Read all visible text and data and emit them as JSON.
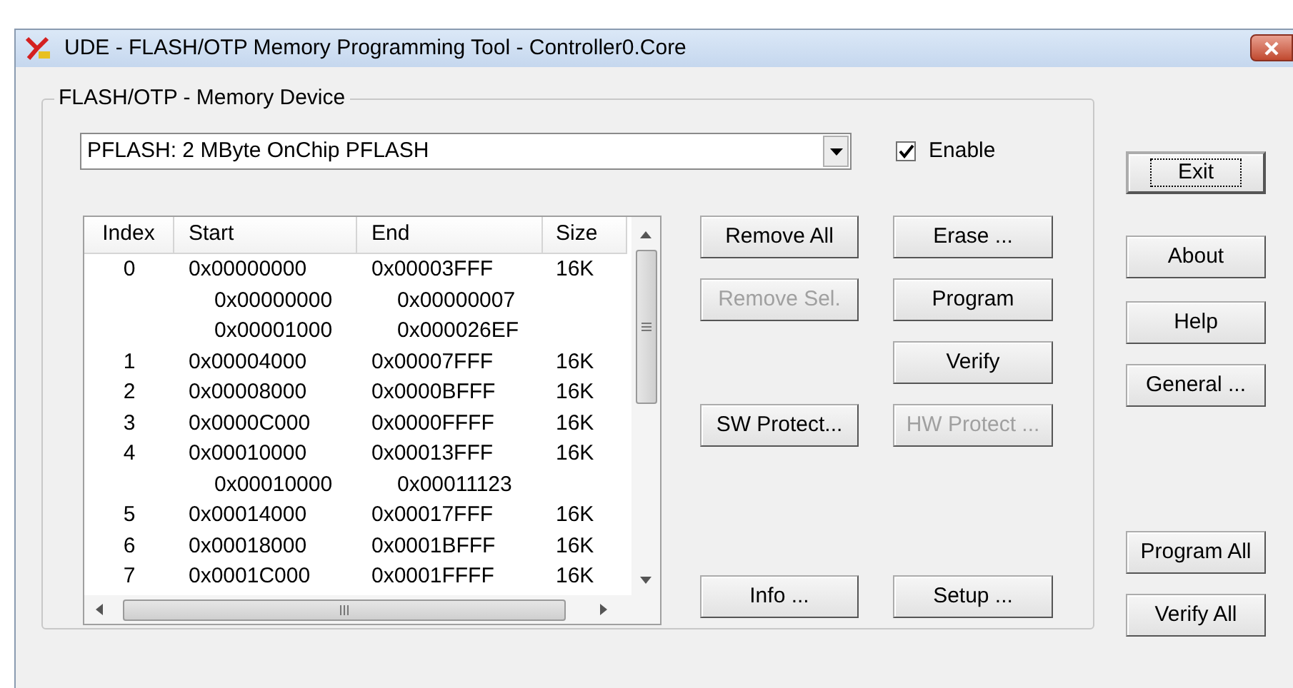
{
  "window": {
    "title": "UDE - FLASH/OTP Memory Programming Tool  - Controller0.Core"
  },
  "group": {
    "label": "FLASH/OTP - Memory Device",
    "device": {
      "value": "PFLASH: 2 MByte OnChip PFLASH"
    },
    "enable": {
      "label": "Enable",
      "checked": true
    },
    "table": {
      "columns": [
        "Index",
        "Start",
        "End",
        "Size"
      ],
      "rows": [
        {
          "kind": "sector",
          "index": "0",
          "start": "0x00000000",
          "end": "0x00003FFF",
          "size": "16K"
        },
        {
          "kind": "range",
          "start": "0x00000000",
          "end": "0x00000007"
        },
        {
          "kind": "range",
          "start": "0x00001000",
          "end": "0x000026EF"
        },
        {
          "kind": "sector",
          "index": "1",
          "start": "0x00004000",
          "end": "0x00007FFF",
          "size": "16K"
        },
        {
          "kind": "sector",
          "index": "2",
          "start": "0x00008000",
          "end": "0x0000BFFF",
          "size": "16K"
        },
        {
          "kind": "sector",
          "index": "3",
          "start": "0x0000C000",
          "end": "0x0000FFFF",
          "size": "16K"
        },
        {
          "kind": "sector",
          "index": "4",
          "start": "0x00010000",
          "end": "0x00013FFF",
          "size": "16K"
        },
        {
          "kind": "range",
          "start": "0x00010000",
          "end": "0x00011123"
        },
        {
          "kind": "sector",
          "index": "5",
          "start": "0x00014000",
          "end": "0x00017FFF",
          "size": "16K"
        },
        {
          "kind": "sector",
          "index": "6",
          "start": "0x00018000",
          "end": "0x0001BFFF",
          "size": "16K"
        },
        {
          "kind": "sector",
          "index": "7",
          "start": "0x0001C000",
          "end": "0x0001FFFF",
          "size": "16K"
        }
      ]
    },
    "buttons": [
      {
        "label": "Remove All",
        "disabled": false
      },
      {
        "label": "Erase ...",
        "disabled": false
      },
      {
        "label": "Remove Sel.",
        "disabled": true
      },
      {
        "label": "Program",
        "disabled": false
      },
      {
        "label": "Verify",
        "disabled": false
      },
      {
        "label": "SW Protect...",
        "disabled": false
      },
      {
        "label": "HW Protect ...",
        "disabled": true
      },
      {
        "label": "Info ...",
        "disabled": false
      },
      {
        "label": "Setup ...",
        "disabled": false
      }
    ]
  },
  "side_buttons": [
    {
      "label": "Exit",
      "focused": true
    },
    {
      "label": "About",
      "focused": false
    },
    {
      "label": "Help",
      "focused": false
    },
    {
      "label": "General ...",
      "focused": false
    },
    {
      "label": "Program All",
      "focused": false
    },
    {
      "label": "Verify All",
      "focused": false
    }
  ]
}
